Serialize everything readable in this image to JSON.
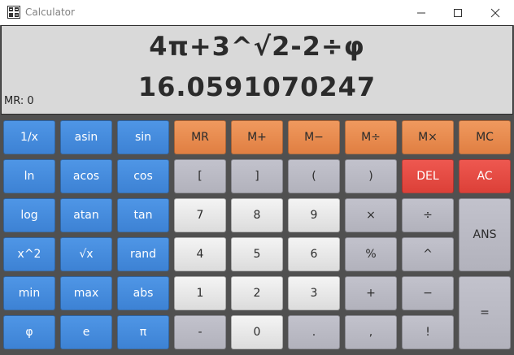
{
  "window": {
    "title": "Calculator",
    "controls": {
      "minimize": "—",
      "maximize": "☐",
      "close": "✕"
    }
  },
  "display": {
    "expression": "4π+3^√2-2÷φ",
    "result": "16.0591070247",
    "memory": "MR: 0"
  },
  "colors": {
    "blue": "#4a90e2",
    "orange": "#ec8a4f",
    "gray": "#bcbcc4",
    "white": "#ececec",
    "red": "#e8493f"
  },
  "buttons": {
    "inv": "1/x",
    "asin": "asin",
    "sin": "sin",
    "mr": "MR",
    "mplus": "M+",
    "mminus": "M−",
    "mdiv": "M÷",
    "mmul": "M×",
    "mc": "MC",
    "ln": "ln",
    "acos": "acos",
    "cos": "cos",
    "lbracket": "[",
    "rbracket": "]",
    "lparen": "(",
    "rparen": ")",
    "del": "DEL",
    "ac": "AC",
    "log": "log",
    "atan": "atan",
    "tan": "tan",
    "d7": "7",
    "d8": "8",
    "d9": "9",
    "mul": "×",
    "div": "÷",
    "ans": "ANS",
    "sq": "x^2",
    "sqrt": "√x",
    "rand": "rand",
    "d4": "4",
    "d5": "5",
    "d6": "6",
    "pct": "%",
    "pow": "^",
    "min": "min",
    "max": "max",
    "abs": "abs",
    "d1": "1",
    "d2": "2",
    "d3": "3",
    "plus": "+",
    "minus": "−",
    "eq": "=",
    "phi": "φ",
    "e": "e",
    "pi": "π",
    "neg": "-",
    "d0": "0",
    "dot": ".",
    "comma": ",",
    "fact": "!"
  }
}
